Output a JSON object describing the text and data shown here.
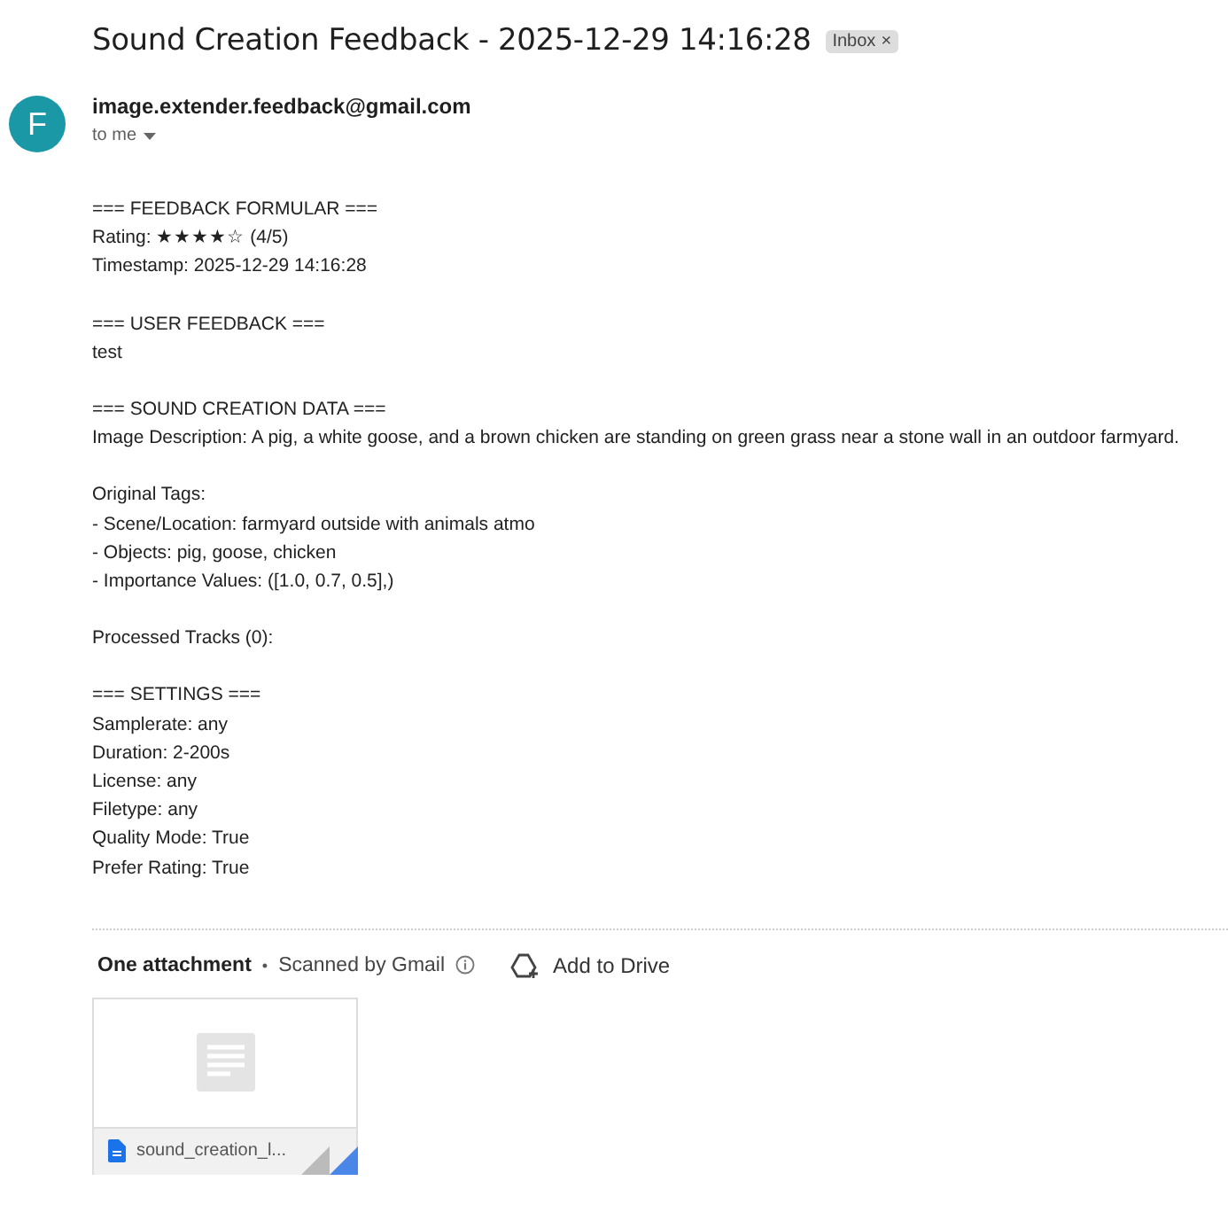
{
  "subject": "Sound Creation Feedback - 2025-12-29 14:16:28",
  "label": {
    "text": "Inbox",
    "remove": "×"
  },
  "sender": {
    "initial": "F",
    "email": "image.extender.feedback@gmail.com",
    "recipient": "to me"
  },
  "body": [
    [
      "=== FEEDBACK FORMULAR ===",
      "Rating: ★★★★☆ (4/5)",
      "Timestamp: 2025-12-29 14:16:28"
    ],
    [
      "=== USER FEEDBACK ===",
      "test"
    ],
    [
      "=== SOUND CREATION DATA ===",
      "Image Description: A pig, a white goose, and a brown chicken are standing on green grass near a stone wall in an outdoor farmyard."
    ],
    [
      "Original Tags:",
      "- Scene/Location: farmyard outside with animals atmo",
      "- Objects: pig, goose, chicken",
      "- Importance Values: ([1.0, 0.7, 0.5],)"
    ],
    [
      "Processed Tracks (0):"
    ],
    [
      "=== SETTINGS ===",
      "Samplerate: any",
      "Duration: 2-200s",
      "License: any",
      "Filetype: any",
      "Quality Mode: True",
      "Prefer Rating: True"
    ]
  ],
  "attachments": {
    "heading": "One attachment",
    "separator": "•",
    "scanned": "Scanned by Gmail",
    "add_to_drive": "Add to Drive",
    "files": [
      {
        "name": "sound_creation_l..."
      }
    ]
  }
}
